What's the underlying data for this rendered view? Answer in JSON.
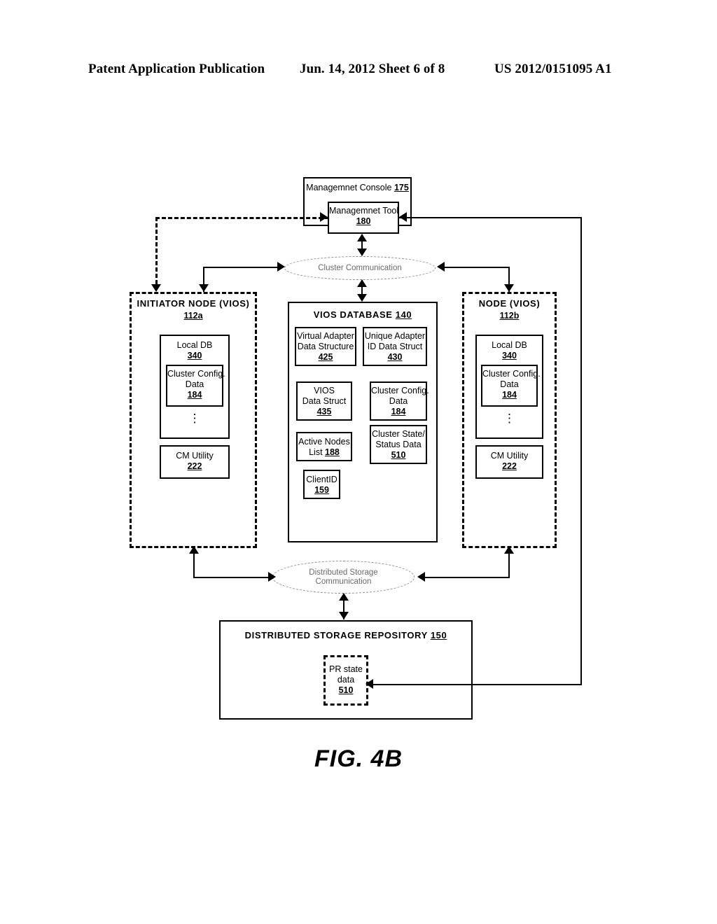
{
  "header": {
    "left": "Patent Application Publication",
    "center": "Jun. 14, 2012  Sheet 6 of 8",
    "right": "US 2012/0151095 A1"
  },
  "figure": {
    "caption": "FIG. 4B"
  },
  "management_console": {
    "title": "Managemnet Console",
    "ref": "175",
    "tool": {
      "title": "Managemnet Tool",
      "ref": "180"
    }
  },
  "cluster_communication": {
    "label": "Cluster Communication"
  },
  "distributed_storage_communication": {
    "line1": "Distributed Storage",
    "line2": "Communication"
  },
  "initiator_node": {
    "title": "INITIATOR NODE (VIOS)",
    "ref": "112a",
    "local_db": {
      "title": "Local DB",
      "ref": "340",
      "cluster_config": {
        "line1": "Cluster Config.",
        "line2": "Data",
        "ref": "184"
      },
      "ellipsis": "⋮"
    },
    "cm_utility": {
      "title": "CM Utility",
      "ref": "222"
    }
  },
  "node": {
    "title": "NODE (VIOS)",
    "ref": "112b",
    "local_db": {
      "title": "Local DB",
      "ref": "340",
      "cluster_config": {
        "line1": "Cluster Config.",
        "line2": "Data",
        "ref": "184"
      },
      "ellipsis": "⋮"
    },
    "cm_utility": {
      "title": "CM Utility",
      "ref": "222"
    }
  },
  "vios_database": {
    "title": "VIOS DATABASE",
    "ref": "140",
    "items": [
      {
        "line1": "Virtual Adapter",
        "line2": "Data Structure",
        "ref": "425"
      },
      {
        "line1": "Unique Adapter",
        "line2": "ID Data Struct",
        "ref": "430"
      },
      {
        "line1": "VIOS",
        "line2": "Data Struct",
        "ref": "435"
      },
      {
        "line1": "Cluster Config.",
        "line2": "Data",
        "ref": "184"
      },
      {
        "line1": "Active Nodes",
        "line2": "List",
        "ref": "188",
        "inline_ref": true
      },
      {
        "line1": "Cluster State/",
        "line2": "Status Data",
        "ref": "510"
      },
      {
        "line1": "ClientID",
        "line2": "",
        "ref": "159"
      }
    ]
  },
  "distributed_storage_repository": {
    "title": "DISTRIBUTED STORAGE REPOSITORY",
    "ref": "150",
    "pr_state_data": {
      "line1": "PR state",
      "line2": "data",
      "ref": "510"
    }
  }
}
